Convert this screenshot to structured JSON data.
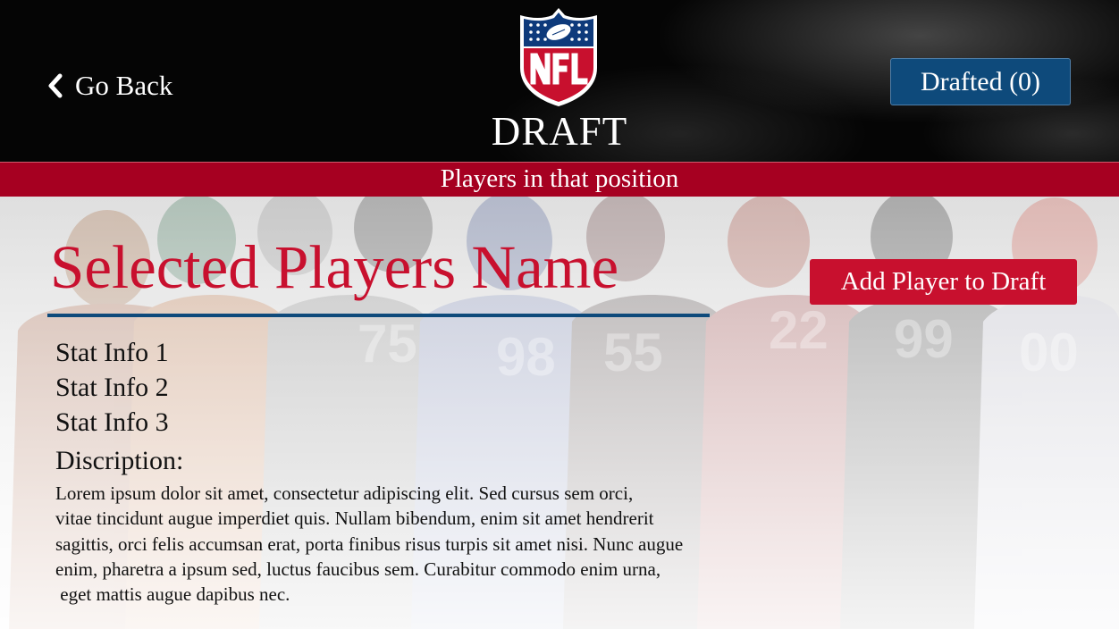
{
  "header": {
    "back_label": "Go Back",
    "logo_text": "NFL",
    "title": "DRAFT",
    "drafted_label": "Drafted (0)"
  },
  "position_bar": {
    "label": "Players in that position"
  },
  "player": {
    "name": "Selected Players Name",
    "add_button_label": "Add Player to Draft",
    "stats": [
      "Stat Info 1",
      "Stat Info 2",
      "Stat Info 3"
    ],
    "description_label": "Discription:",
    "description_lines": [
      "Lorem ipsum dolor sit amet, consectetur adipiscing elit. Sed cursus sem orci,",
      "vitae tincidunt augue imperdiet quis. Nullam bibendum, enim sit amet hendrerit",
      "sagittis, orci felis accumsan erat, porta finibus risus turpis sit amet nisi. Nunc augue",
      "enim, pharetra a ipsum sed, luctus faucibus sem. Curabitur commodo enim urna,",
      " eget mattis augue dapibus nec."
    ]
  },
  "background_jersey_numbers": [
    "75",
    "98",
    "55",
    "22",
    "99",
    "00"
  ],
  "icons": {
    "back": "chevron-left-icon",
    "logo": "nfl-shield-logo"
  },
  "colors": {
    "header_bg": "#050505",
    "position_bar": "#a60021",
    "accent_red": "#c8102e",
    "accent_blue": "#0e4a7b",
    "text_dark": "#111111"
  }
}
